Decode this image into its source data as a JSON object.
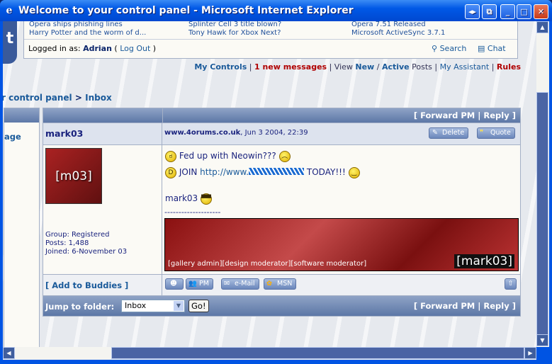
{
  "window": {
    "title": "Welcome to your control panel - Microsoft Internet Explorer"
  },
  "news": {
    "col1": [
      "Opera ships phishing lines",
      "Harry Potter and the worm of d..."
    ],
    "col2": [
      "Splinter Cell 3 title blown?",
      "Tony Hawk for Xbox Next?"
    ],
    "col3": [
      "Opera 7.51 Released",
      "Microsoft ActiveSync 3.7.1"
    ]
  },
  "login": {
    "prefix": "Logged in as: ",
    "user": "Adrian",
    "logout": "Log Out",
    "search": "Search",
    "chat": "Chat"
  },
  "nav": {
    "my_controls": "My Controls",
    "new_messages": "1 new messages",
    "view": "View",
    "new": "New",
    "active": "Active",
    "posts": "Posts",
    "assistant": "My Assistant",
    "rules": "Rules"
  },
  "breadcrumb": {
    "parent": "r control panel",
    "sep": ">",
    "current": "Inbox"
  },
  "sidebar": {
    "partial_link": "age"
  },
  "pm": {
    "header_actions": "[ Forward PM | Reply ]",
    "author": "mark03",
    "site": "www.4orums.co.uk",
    "date": ", Jun 3 2004, 22:39",
    "delete": "Delete",
    "quote": "Quote",
    "avatar_text": "[m03]",
    "group": "Group: Registered",
    "posts": "Posts: 1,488",
    "joined": "Joined: 6-November 03",
    "line1": "Fed up with Neowin???",
    "join": "JOIN",
    "url": "http://www.",
    "today": "TODAY!!!",
    "sign": "mark03",
    "sig_rule": "--------------------",
    "sig_roles": "[gallery admin][design moderator][software moderator]",
    "sig_name": "[mark03]",
    "add_buddies": "Add to Buddies",
    "pm_btn": "PM",
    "email_btn": "e-Mail",
    "msn_btn": "MSN"
  },
  "footer": {
    "jump_label": "Jump to folder:",
    "folder": "Inbox",
    "go": "Go!",
    "actions": "[ Forward PM | Reply ]"
  }
}
